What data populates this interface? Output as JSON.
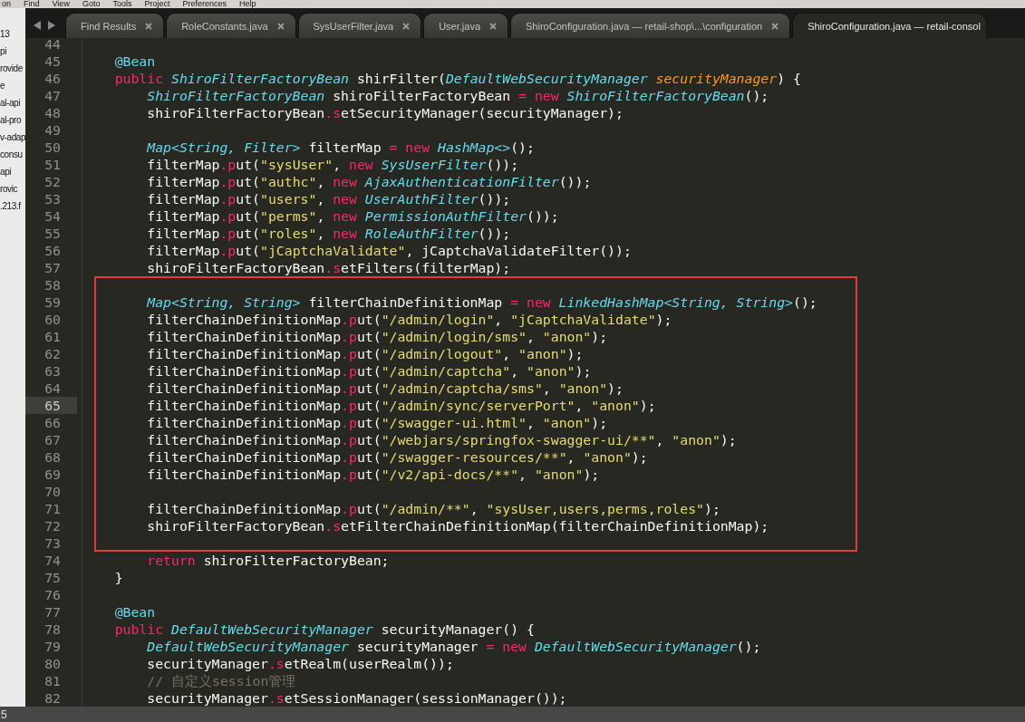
{
  "menu_bar": {
    "items": [
      "on",
      "Find",
      "View",
      "Goto",
      "Tools",
      "Project",
      "Preferences",
      "Help"
    ]
  },
  "sidebar": {
    "items": [
      "13",
      "pi",
      "rovide",
      "e",
      "al-api",
      "al-pro",
      "v-adap",
      "consu",
      "api",
      "rovic",
      ".213.f"
    ]
  },
  "tabs": [
    {
      "label": "Find Results",
      "selected": false
    },
    {
      "label": "RoleConstants.java",
      "selected": false
    },
    {
      "label": "SysUserFilter.java",
      "selected": false
    },
    {
      "label": "User.java",
      "selected": false
    },
    {
      "label": "ShiroConfiguration.java — retail-shop\\...\\configuration",
      "selected": false
    },
    {
      "label": "ShiroConfiguration.java — retail-consol",
      "selected": true
    }
  ],
  "editor": {
    "blocks": [
      {
        "boxed": false,
        "lines": [
          {
            "number": "44",
            "current": false
          },
          {
            "number": "45",
            "current": false,
            "tokens": [
              {
                "text": "    @Bean",
                "kind": "annotation"
              }
            ]
          },
          {
            "number": "46",
            "current": false,
            "tokens": [
              {
                "text": "    public ",
                "kind": "keyword"
              },
              {
                "text": "ShiroFilterFactoryBean",
                "kind": "type"
              },
              {
                "text": " shirFilter(",
                "kind": "plain"
              },
              {
                "text": "DefaultWebSecurityManager",
                "kind": "type"
              },
              {
                "text": " securityManager",
                "kind": "param"
              },
              {
                "text": ") {",
                "kind": "plain"
              }
            ]
          },
          {
            "number": "47",
            "current": false,
            "tokens": [
              {
                "text": "        ShiroFilterFactoryBean",
                "kind": "type"
              },
              {
                "text": " shiroFilterFactoryBean ",
                "kind": "plain"
              },
              {
                "text": "= new ",
                "kind": "keyword"
              },
              {
                "text": "ShiroFilterFactoryBean",
                "kind": "type"
              },
              {
                "text": "();",
                "kind": "plain"
              }
            ]
          },
          {
            "number": "48",
            "current": false,
            "tokens": [
              {
                "text": "        shiroFilterFactoryBean",
                "kind": "plain"
              },
              {
                "text": ".setSecurityManager(securityManager);",
                "kind": "member"
              }
            ]
          },
          {
            "number": "49",
            "current": false
          },
          {
            "number": "50",
            "current": false,
            "tokens": [
              {
                "text": "        Map<String, Filter>",
                "kind": "type"
              },
              {
                "text": " filterMap ",
                "kind": "plain"
              },
              {
                "text": "= new ",
                "kind": "keyword"
              },
              {
                "text": "HashMap<>",
                "kind": "type"
              },
              {
                "text": "();",
                "kind": "plain"
              }
            ]
          },
          {
            "number": "51",
            "current": false,
            "tokens": [
              {
                "text": "        filterMap",
                "kind": "plain"
              },
              {
                "text": ".put(",
                "kind": "member"
              },
              {
                "text": "\"sysUser\"",
                "kind": "string"
              },
              {
                "text": ",",
                "kind": "plain"
              },
              {
                "text": " new ",
                "kind": "keyword"
              },
              {
                "text": "SysUserFilter",
                "kind": "type"
              },
              {
                "text": "());",
                "kind": "plain"
              }
            ]
          },
          {
            "number": "52",
            "current": false,
            "tokens": [
              {
                "text": "        filterMap",
                "kind": "plain"
              },
              {
                "text": ".put(",
                "kind": "member"
              },
              {
                "text": "\"authc\"",
                "kind": "string"
              },
              {
                "text": ",",
                "kind": "plain"
              },
              {
                "text": " new ",
                "kind": "keyword"
              },
              {
                "text": "AjaxAuthenticationFilter",
                "kind": "type"
              },
              {
                "text": "());",
                "kind": "plain"
              }
            ]
          },
          {
            "number": "53",
            "current": false,
            "tokens": [
              {
                "text": "        filterMap",
                "kind": "plain"
              },
              {
                "text": ".put(",
                "kind": "member"
              },
              {
                "text": "\"users\"",
                "kind": "string"
              },
              {
                "text": ",",
                "kind": "plain"
              },
              {
                "text": " new ",
                "kind": "keyword"
              },
              {
                "text": "UserAuthFilter",
                "kind": "type"
              },
              {
                "text": "());",
                "kind": "plain"
              }
            ]
          },
          {
            "number": "54",
            "current": false,
            "tokens": [
              {
                "text": "        filterMap",
                "kind": "plain"
              },
              {
                "text": ".put(",
                "kind": "member"
              },
              {
                "text": "\"perms\"",
                "kind": "string"
              },
              {
                "text": ",",
                "kind": "plain"
              },
              {
                "text": " new ",
                "kind": "keyword"
              },
              {
                "text": "PermissionAuthFilter",
                "kind": "type"
              },
              {
                "text": "());",
                "kind": "plain"
              }
            ]
          },
          {
            "number": "55",
            "current": false,
            "tokens": [
              {
                "text": "        filterMap",
                "kind": "plain"
              },
              {
                "text": ".put(",
                "kind": "member"
              },
              {
                "text": "\"roles\"",
                "kind": "string"
              },
              {
                "text": ",",
                "kind": "plain"
              },
              {
                "text": " new ",
                "kind": "keyword"
              },
              {
                "text": "RoleAuthFilter",
                "kind": "type"
              },
              {
                "text": "());",
                "kind": "plain"
              }
            ]
          },
          {
            "number": "56",
            "current": false,
            "tokens": [
              {
                "text": "        filterMap",
                "kind": "plain"
              },
              {
                "text": ".put(",
                "kind": "member"
              },
              {
                "text": "\"jCaptchaValidate\"",
                "kind": "string"
              },
              {
                "text": ", jCaptchaValidateFilter());",
                "kind": "plain"
              }
            ]
          },
          {
            "number": "57",
            "current": false,
            "tokens": [
              {
                "text": "        shiroFilterFactoryBean",
                "kind": "plain"
              },
              {
                "text": ".setFilters(filterMap);",
                "kind": "member"
              }
            ]
          }
        ]
      },
      {
        "boxed": true,
        "lines": [
          {
            "number": "58",
            "current": false
          },
          {
            "number": "59",
            "current": false,
            "tokens": [
              {
                "text": "        Map<String, String>",
                "kind": "type"
              },
              {
                "text": " filterChainDefinitionMap ",
                "kind": "plain"
              },
              {
                "text": "= new ",
                "kind": "keyword"
              },
              {
                "text": "LinkedHashMap<String, String>",
                "kind": "type"
              },
              {
                "text": "();",
                "kind": "plain"
              }
            ]
          },
          {
            "number": "60",
            "current": false,
            "tokens": [
              {
                "text": "        filterChainDefinitionMap",
                "kind": "plain"
              },
              {
                "text": ".put(",
                "kind": "member"
              },
              {
                "text": "\"/admin/login\"",
                "kind": "string"
              },
              {
                "text": ", ",
                "kind": "plain"
              },
              {
                "text": "\"jCaptchaValidate\"",
                "kind": "string"
              },
              {
                "text": ");",
                "kind": "plain"
              }
            ]
          },
          {
            "number": "61",
            "current": false,
            "tokens": [
              {
                "text": "        filterChainDefinitionMap",
                "kind": "plain"
              },
              {
                "text": ".put(",
                "kind": "member"
              },
              {
                "text": "\"/admin/login/sms\"",
                "kind": "string"
              },
              {
                "text": ", ",
                "kind": "plain"
              },
              {
                "text": "\"anon\"",
                "kind": "string"
              },
              {
                "text": ");",
                "kind": "plain"
              }
            ]
          },
          {
            "number": "62",
            "current": false,
            "tokens": [
              {
                "text": "        filterChainDefinitionMap",
                "kind": "plain"
              },
              {
                "text": ".put(",
                "kind": "member"
              },
              {
                "text": "\"/admin/logout\"",
                "kind": "string"
              },
              {
                "text": ", ",
                "kind": "plain"
              },
              {
                "text": "\"anon\"",
                "kind": "string"
              },
              {
                "text": ");",
                "kind": "plain"
              }
            ]
          },
          {
            "number": "63",
            "current": false,
            "tokens": [
              {
                "text": "        filterChainDefinitionMap",
                "kind": "plain"
              },
              {
                "text": ".put(",
                "kind": "member"
              },
              {
                "text": "\"/admin/captcha\"",
                "kind": "string"
              },
              {
                "text": ", ",
                "kind": "plain"
              },
              {
                "text": "\"anon\"",
                "kind": "string"
              },
              {
                "text": ");",
                "kind": "plain"
              }
            ]
          },
          {
            "number": "64",
            "current": false,
            "tokens": [
              {
                "text": "        filterChainDefinitionMap",
                "kind": "plain"
              },
              {
                "text": ".put(",
                "kind": "member"
              },
              {
                "text": "\"/admin/captcha/sms\"",
                "kind": "string"
              },
              {
                "text": ", ",
                "kind": "plain"
              },
              {
                "text": "\"anon\"",
                "kind": "string"
              },
              {
                "text": ");",
                "kind": "plain"
              }
            ]
          },
          {
            "number": "65",
            "current": true,
            "tokens": [
              {
                "text": "        filterChainDefinitionMap",
                "kind": "plain"
              },
              {
                "text": ".put(",
                "kind": "member"
              },
              {
                "text": "\"/admin/sync/serverPort\"",
                "kind": "string"
              },
              {
                "text": ", ",
                "kind": "plain"
              },
              {
                "text": "\"anon\"",
                "kind": "string"
              },
              {
                "text": ");",
                "kind": "plain"
              }
            ]
          },
          {
            "number": "66",
            "current": false,
            "tokens": [
              {
                "text": "        filterChainDefinitionMap",
                "kind": "plain"
              },
              {
                "text": ".put(",
                "kind": "member"
              },
              {
                "text": "\"/swagger-ui.html\"",
                "kind": "string"
              },
              {
                "text": ", ",
                "kind": "plain"
              },
              {
                "text": "\"anon\"",
                "kind": "string"
              },
              {
                "text": ");",
                "kind": "plain"
              }
            ]
          },
          {
            "number": "67",
            "current": false,
            "tokens": [
              {
                "text": "        filterChainDefinitionMap",
                "kind": "plain"
              },
              {
                "text": ".put(",
                "kind": "member"
              },
              {
                "text": "\"/webjars/springfox-swagger-ui/**\"",
                "kind": "string"
              },
              {
                "text": ", ",
                "kind": "plain"
              },
              {
                "text": "\"anon\"",
                "kind": "string"
              },
              {
                "text": ");",
                "kind": "plain"
              }
            ]
          },
          {
            "number": "68",
            "current": false,
            "tokens": [
              {
                "text": "        filterChainDefinitionMap",
                "kind": "plain"
              },
              {
                "text": ".put(",
                "kind": "member"
              },
              {
                "text": "\"/swagger-resources/**\"",
                "kind": "string"
              },
              {
                "text": ", ",
                "kind": "plain"
              },
              {
                "text": "\"anon\"",
                "kind": "string"
              },
              {
                "text": ");",
                "kind": "plain"
              }
            ]
          },
          {
            "number": "69",
            "current": false,
            "tokens": [
              {
                "text": "        filterChainDefinitionMap",
                "kind": "plain"
              },
              {
                "text": ".put(",
                "kind": "member"
              },
              {
                "text": "\"/v2/api-docs/**\"",
                "kind": "string"
              },
              {
                "text": ", ",
                "kind": "plain"
              },
              {
                "text": "\"anon\"",
                "kind": "string"
              },
              {
                "text": ");",
                "kind": "plain"
              }
            ]
          },
          {
            "number": "70",
            "current": false
          },
          {
            "number": "71",
            "current": false,
            "tokens": [
              {
                "text": "        filterChainDefinitionMap",
                "kind": "plain"
              },
              {
                "text": ".put(",
                "kind": "member"
              },
              {
                "text": "\"/admin/**\"",
                "kind": "string"
              },
              {
                "text": ", ",
                "kind": "plain"
              },
              {
                "text": "\"sysUser,users,perms,roles\"",
                "kind": "string"
              },
              {
                "text": ");",
                "kind": "plain"
              }
            ]
          },
          {
            "number": "72",
            "current": false,
            "tokens": [
              {
                "text": "        shiroFilterFactoryBean",
                "kind": "plain"
              },
              {
                "text": ".setFilterChainDefinitionMap(filterChainDefinitionMap);",
                "kind": "member"
              }
            ]
          },
          {
            "number": "73",
            "current": false
          }
        ]
      },
      {
        "boxed": false,
        "lines": [
          {
            "number": "74",
            "current": false,
            "tokens": [
              {
                "text": "        return",
                "kind": "keyword"
              },
              {
                "text": " shiroFilterFactoryBean;",
                "kind": "plain"
              }
            ]
          },
          {
            "number": "75",
            "current": false,
            "tokens": [
              {
                "text": "    }",
                "kind": "plain"
              }
            ]
          },
          {
            "number": "76",
            "current": false
          },
          {
            "number": "77",
            "current": false,
            "tokens": [
              {
                "text": "    @Bean",
                "kind": "annotation"
              }
            ]
          },
          {
            "number": "78",
            "current": false,
            "tokens": [
              {
                "text": "    public ",
                "kind": "keyword"
              },
              {
                "text": "DefaultWebSecurityManager",
                "kind": "type"
              },
              {
                "text": " securityManager() {",
                "kind": "plain"
              }
            ]
          },
          {
            "number": "79",
            "current": false,
            "tokens": [
              {
                "text": "        DefaultWebSecurityManager",
                "kind": "type"
              },
              {
                "text": " securityManager ",
                "kind": "plain"
              },
              {
                "text": "= new ",
                "kind": "keyword"
              },
              {
                "text": "DefaultWebSecurityManager",
                "kind": "type"
              },
              {
                "text": "();",
                "kind": "plain"
              }
            ]
          },
          {
            "number": "80",
            "current": false,
            "tokens": [
              {
                "text": "        securityManager",
                "kind": "plain"
              },
              {
                "text": ".setRealm(userRealm());",
                "kind": "member"
              }
            ]
          },
          {
            "number": "81",
            "current": false,
            "tokens": [
              {
                "text": "        // 自定义session管理",
                "kind": "comment"
              }
            ]
          },
          {
            "number": "82",
            "current": false,
            "tokens": [
              {
                "text": "        securityManager",
                "kind": "plain"
              },
              {
                "text": ".setSessionManager(sessionManager());",
                "kind": "member"
              }
            ]
          }
        ]
      }
    ]
  },
  "status_bar": {
    "text": "5"
  }
}
